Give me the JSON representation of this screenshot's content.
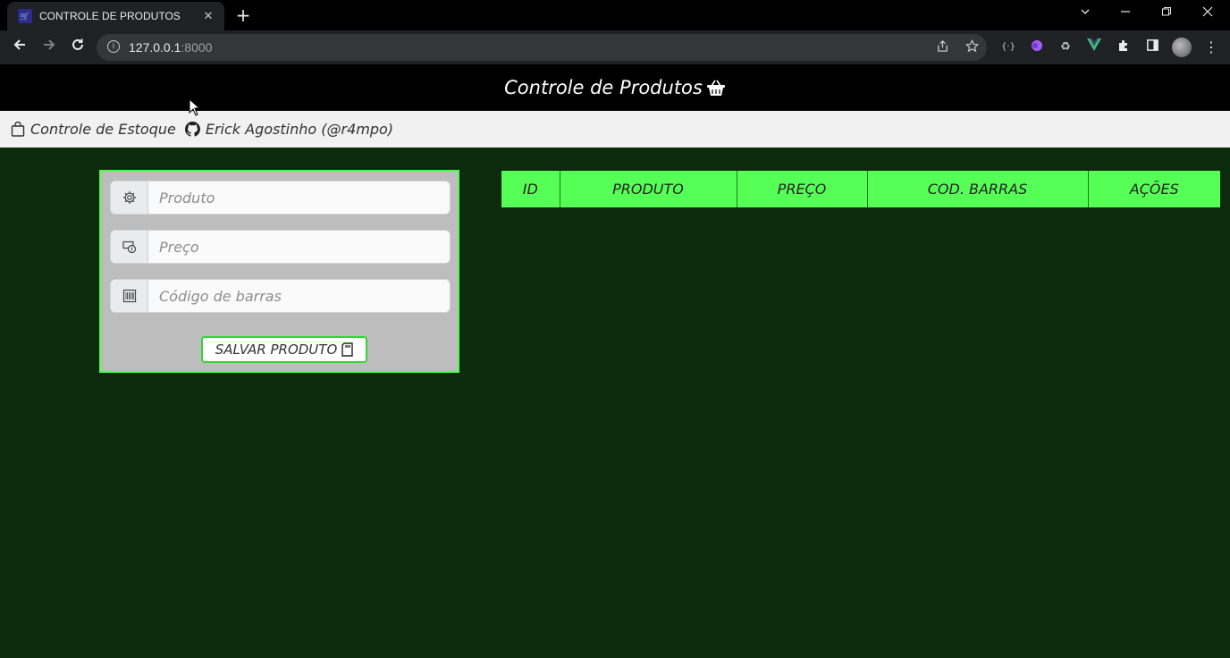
{
  "browser": {
    "tab_title": "CONTROLE DE PRODUTOS",
    "tab_close": "✕",
    "new_tab": "+",
    "url_host": "127.0.0.1",
    "url_port": ":8000",
    "window_controls": [
      "chevron-down-icon",
      "minimize-icon",
      "restore-icon",
      "close-icon"
    ]
  },
  "header": {
    "title": "Controle de Produtos"
  },
  "subnav": {
    "items": [
      {
        "label": "Controle de Estoque",
        "icon": "shopping-bag-icon"
      },
      {
        "label": "Erick Agostinho (@r4mpo)",
        "icon": "github-icon"
      }
    ]
  },
  "form": {
    "fields": [
      {
        "placeholder": "Produto",
        "icon": "gear-icon"
      },
      {
        "placeholder": "Preço",
        "icon": "cash-coin-icon"
      },
      {
        "placeholder": "Código de barras",
        "icon": "barcode-icon"
      }
    ],
    "save_label": "SALVAR PRODUTO"
  },
  "table": {
    "columns": [
      "ID",
      "PRODUTO",
      "PREÇO",
      "COD. BARRAS",
      "AÇÕES"
    ],
    "rows": []
  },
  "colors": {
    "page_bg": "#0c2a0c",
    "accent_green": "#55ff55",
    "header_bg": "#000000",
    "form_bg": "#bdbdbd"
  }
}
